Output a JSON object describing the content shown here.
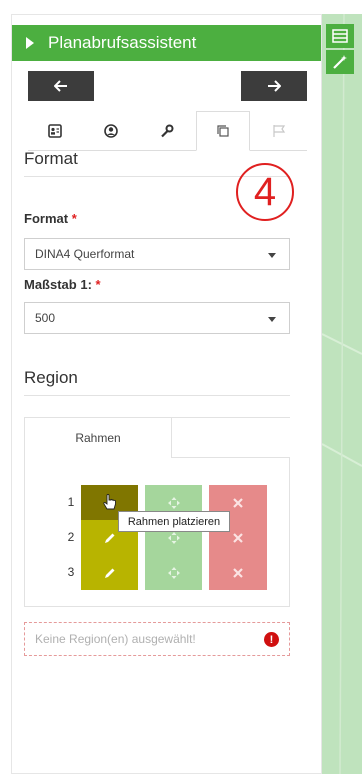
{
  "header": {
    "title": "Planabrufsassistent"
  },
  "format_section": {
    "title": "Format",
    "format_label": "Format",
    "format_value": "DINA4 Querformat",
    "scale_label": "Maßstab 1:",
    "scale_value": "500",
    "required_mark": "*"
  },
  "step_badge": "4",
  "region_section": {
    "title": "Region",
    "tab_label": "Rahmen",
    "rows": [
      "1",
      "2",
      "3"
    ],
    "tooltip": "Rahmen platzieren",
    "status_text": "Keine Region(en) ausgewählt!",
    "status_icon": "!"
  },
  "colors": {
    "header_green": "#4caf40",
    "edit_olive": "#b8b400",
    "move_green": "#a5d69c",
    "delete_red": "#e68a8a",
    "badge_red": "#e02020"
  }
}
